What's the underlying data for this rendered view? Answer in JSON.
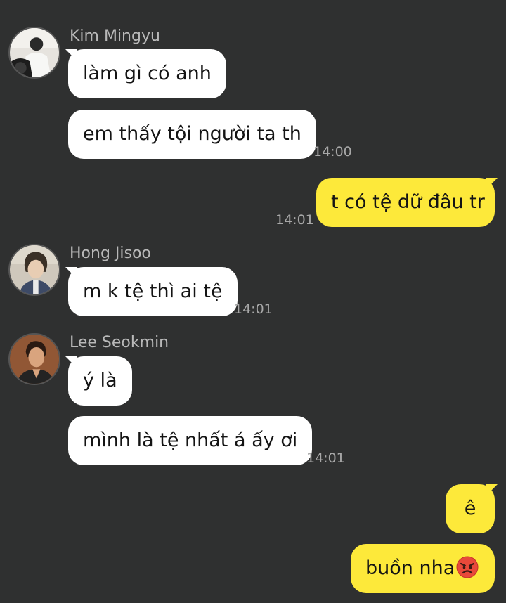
{
  "colors": {
    "background": "#2f3030",
    "incoming_bubble": "#ffffff",
    "outgoing_bubble": "#fde93a",
    "sender_name": "#b9b9b9",
    "timestamp": "#a8a8a8"
  },
  "groups": [
    {
      "sender": "Kim Mingyu",
      "avatar_icon": "avatar-kim-mingyu",
      "messages": [
        "làm gì có anh",
        "em thấy tội người ta th"
      ],
      "time": "14:00"
    },
    {
      "sender": "Hong Jisoo",
      "avatar_icon": "avatar-hong-jisoo",
      "messages": [
        "m k tệ thì ai tệ"
      ],
      "time": "14:01"
    },
    {
      "sender": "Lee Seokmin",
      "avatar_icon": "avatar-lee-seokmin",
      "messages": [
        "ý là",
        "mình là tệ nhất á ấy ơi"
      ],
      "time": "14:01"
    }
  ],
  "outgoing": [
    {
      "text": "t có tệ dữ đâu tr",
      "time": "14:01"
    },
    {
      "text": "ê"
    },
    {
      "text": "buồn nha",
      "emoji": "angry-face-emoji"
    }
  ]
}
